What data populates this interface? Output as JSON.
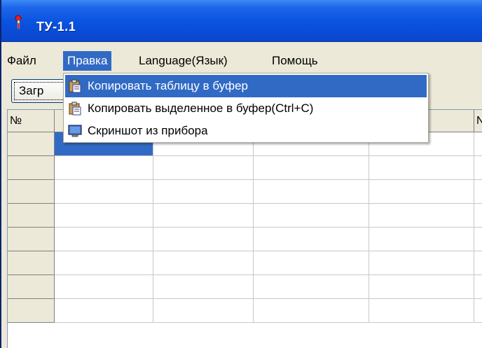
{
  "window": {
    "title": "ТУ-1.1",
    "icon": "thermometer-icon"
  },
  "menubar": {
    "items": [
      {
        "label": "Файл"
      },
      {
        "label": "Правка",
        "active": true
      },
      {
        "label": "Language(Язык)"
      },
      {
        "label": "Помощь"
      }
    ]
  },
  "toolbar": {
    "load_label": "Загр"
  },
  "dropdown": {
    "items": [
      {
        "label": "Копировать таблицу в буфер",
        "icon": "clipboard-icon",
        "highlighted": true
      },
      {
        "label": "Копировать выделенное в буфер(Ctrl+C)",
        "icon": "clipboard-icon"
      },
      {
        "label": "Скриншот из прибора",
        "icon": "monitor-icon"
      }
    ]
  },
  "grid": {
    "headers": [
      "№",
      "",
      "",
      "",
      "",
      "N"
    ],
    "selected_row": 0,
    "selected_col": 0
  },
  "colors": {
    "titlebar": "#0a54e2",
    "selection": "#316ac5",
    "chrome": "#ece9d8"
  }
}
